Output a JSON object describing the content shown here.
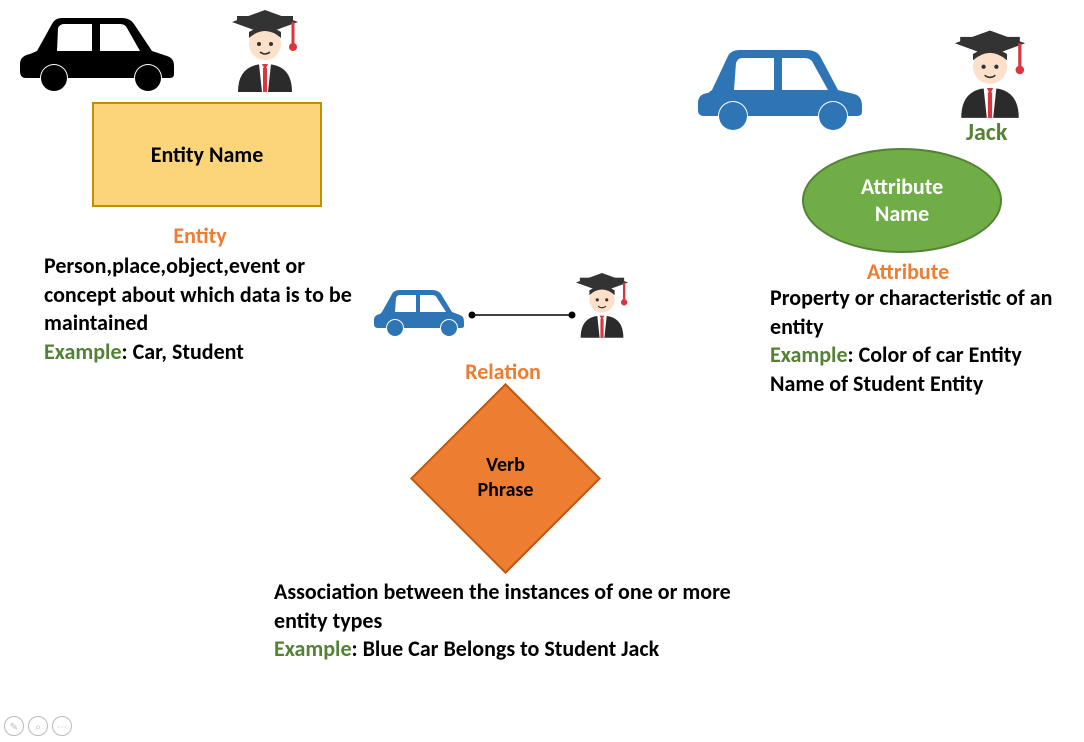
{
  "entity": {
    "box_label": "Entity Name",
    "heading": "Entity",
    "body": "Person,place,object,event or concept about which data is to be maintained",
    "example_label": "Example",
    "example_text": ": Car, Student"
  },
  "relation": {
    "heading": "Relation",
    "diamond_label_line1": "Verb",
    "diamond_label_line2": "Phrase",
    "body": "Association between the instances of one or more entity types",
    "example_label": "Example",
    "example_text": ": Blue Car Belongs to Student Jack"
  },
  "attribute": {
    "heading": "Attribute",
    "ellipse_label_line1": "Attribute",
    "ellipse_label_line2": "Name",
    "body": "Property or characteristic of an entity",
    "example_label": "Example",
    "example_text": ": Color of car Entity Name of Student Entity",
    "jack_label": "Jack"
  }
}
